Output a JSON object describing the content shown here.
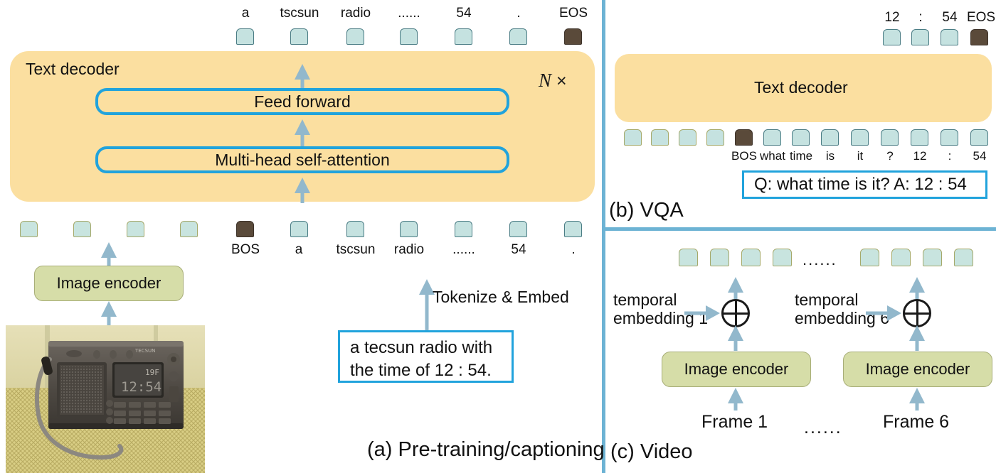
{
  "colors": {
    "decoder_fill": "#FBDFA0",
    "sublayer_border": "#21A3DC",
    "encoder_fill": "#D6DDA8",
    "token_fill": "#C5E2E0",
    "token_special_fill": "#5A4A3A",
    "arrow": "#92B8CC",
    "divider": "#6DB3D4"
  },
  "panel_a": {
    "caption": "(a) Pre-training/captioning",
    "decoder_title": "Text decoder",
    "repeat_label": "N ×",
    "repeat_n": "N",
    "repeat_times": "×",
    "sublayer_top": "Feed forward",
    "sublayer_bottom": "Multi-head self-attention",
    "encoder_label": "Image encoder",
    "tokenize_label": "Tokenize & Embed",
    "caption_text_line1": "a tecsun radio with",
    "caption_text_line2": "the time of 12 : 54.",
    "output_tokens": [
      {
        "label": "a",
        "type": "text"
      },
      {
        "label": "tscsun",
        "type": "text"
      },
      {
        "label": "radio",
        "type": "text"
      },
      {
        "label": "......",
        "type": "text"
      },
      {
        "label": "54",
        "type": "text"
      },
      {
        "label": ".",
        "type": "text"
      },
      {
        "label": "EOS",
        "type": "special"
      }
    ],
    "image_tokens_count": 4,
    "input_tokens": [
      {
        "label": "BOS",
        "type": "special"
      },
      {
        "label": "a",
        "type": "text"
      },
      {
        "label": "tscsun",
        "type": "text"
      },
      {
        "label": "radio",
        "type": "text"
      },
      {
        "label": "......",
        "type": "text"
      },
      {
        "label": "54",
        "type": "text"
      },
      {
        "label": ".",
        "type": "text"
      }
    ],
    "photo_alt": "TECSUN portable radio on a woven mat, display showing 12:54"
  },
  "panel_b": {
    "caption": "(b) VQA",
    "decoder_title": "Text decoder",
    "qa_text": "Q: what time is it? A: 12 : 54",
    "output_tokens": [
      {
        "label": "12",
        "type": "text"
      },
      {
        "label": ":",
        "type": "text"
      },
      {
        "label": "54",
        "type": "text"
      },
      {
        "label": "EOS",
        "type": "special"
      }
    ],
    "image_tokens_count": 4,
    "input_tokens": [
      {
        "label": "BOS",
        "type": "special"
      },
      {
        "label": "what",
        "type": "text"
      },
      {
        "label": "time",
        "type": "text"
      },
      {
        "label": "is",
        "type": "text"
      },
      {
        "label": "it",
        "type": "text"
      },
      {
        "label": "?",
        "type": "text"
      },
      {
        "label": "12",
        "type": "text"
      },
      {
        "label": ":",
        "type": "text"
      },
      {
        "label": "54",
        "type": "text"
      }
    ]
  },
  "panel_c": {
    "caption": "(c) Video",
    "encoder_label_1": "Image encoder",
    "encoder_label_2": "Image encoder",
    "temporal_1_line1": "temporal",
    "temporal_1_line2": "embedding 1",
    "temporal_6_line1": "temporal",
    "temporal_6_line2": "embedding 6",
    "frame_1": "Frame 1",
    "frame_6": "Frame 6",
    "frames_ellipsis": "......",
    "tokens_ellipsis": "......",
    "tokens_left_count": 4,
    "tokens_right_count": 4,
    "plus_symbol": "⊕"
  }
}
